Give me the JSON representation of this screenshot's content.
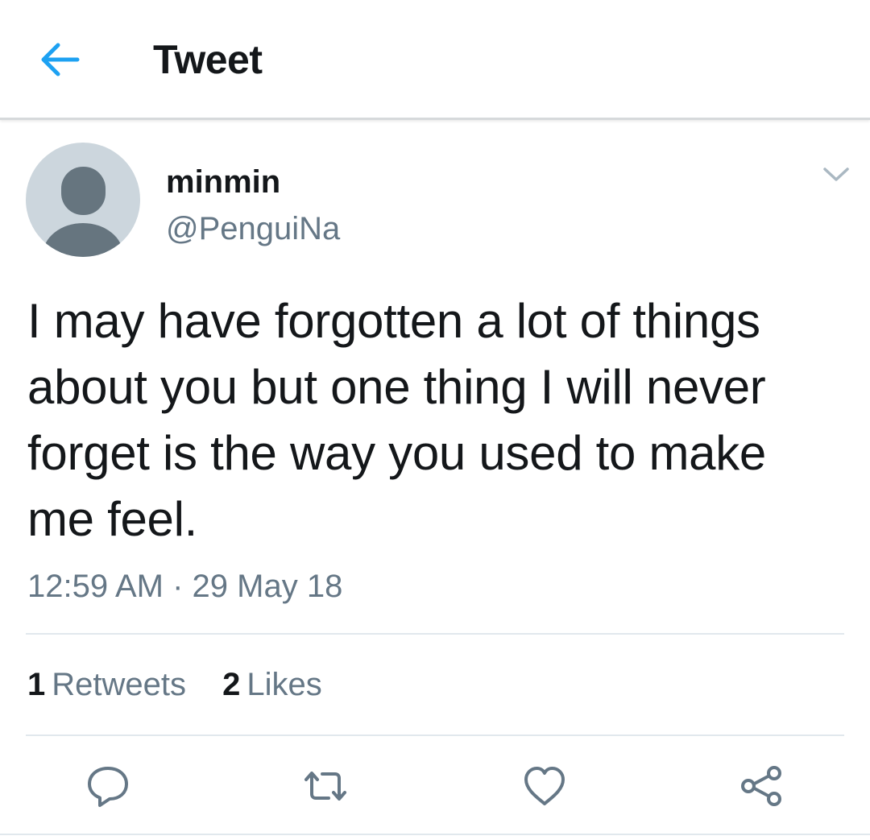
{
  "header": {
    "title": "Tweet",
    "back_icon": "arrow-left-icon"
  },
  "tweet": {
    "author": {
      "display_name": "minmin",
      "handle": "@PenguiNa",
      "avatar": "default-avatar-placeholder"
    },
    "text": "I may have forgotten a lot of things about you but one thing I will never forget is the way you used to make me feel.",
    "timestamp": "12:59 AM · 29 May 18",
    "stats": {
      "retweets_count": "1",
      "retweets_label": "Retweets",
      "likes_count": "2",
      "likes_label": "Likes"
    },
    "actions": [
      "reply-icon",
      "retweet-icon",
      "like-icon",
      "share-icon"
    ]
  },
  "colors": {
    "accent": "#1da1f2",
    "text_primary": "#14171a",
    "text_secondary": "#657786",
    "divider": "#e1e8ed",
    "avatar_bg": "#ccd6dd",
    "avatar_fg": "#66757f"
  }
}
